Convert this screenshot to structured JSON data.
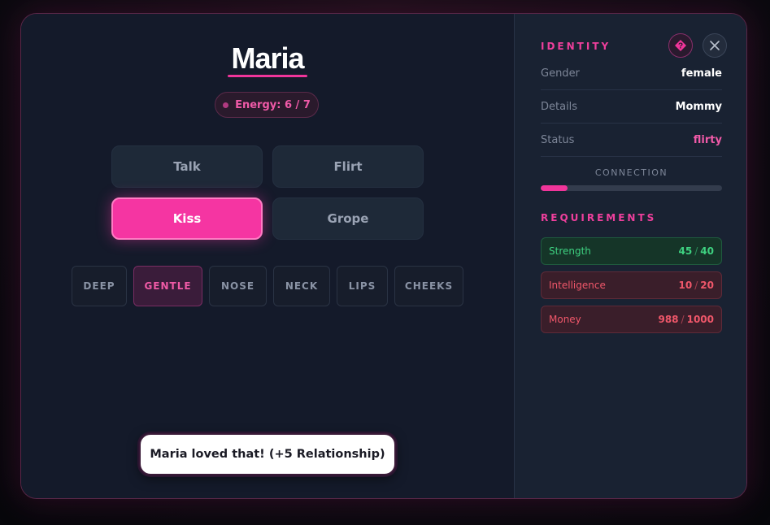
{
  "character": {
    "name": "Maria",
    "energy_label": "Energy: 6 / 7"
  },
  "actions": [
    {
      "label": "Talk",
      "active": false
    },
    {
      "label": "Flirt",
      "active": false
    },
    {
      "label": "Kiss",
      "active": true
    },
    {
      "label": "Grope",
      "active": false
    }
  ],
  "kiss_options": [
    {
      "label": "DEEP",
      "active": false
    },
    {
      "label": "GENTLE",
      "active": true
    },
    {
      "label": "NOSE",
      "active": false
    },
    {
      "label": "NECK",
      "active": false
    },
    {
      "label": "LIPS",
      "active": false
    },
    {
      "label": "CHEEKS",
      "active": false
    }
  ],
  "toast": "Maria loved that! (+5 Relationship)",
  "identity": {
    "title": "IDENTITY",
    "rows": [
      {
        "key": "Gender",
        "value": "female"
      },
      {
        "key": "Details",
        "value": "Mommy"
      },
      {
        "key": "Status",
        "value": "flirty"
      }
    ],
    "connection_label": "CONNECTION",
    "connection_level": 0.15
  },
  "requirements": {
    "title": "REQUIREMENTS",
    "items": [
      {
        "name": "Strength",
        "current": "45",
        "required": "40",
        "met": true
      },
      {
        "name": "Intelligence",
        "current": "10",
        "required": "20",
        "met": false
      },
      {
        "name": "Money",
        "current": "988",
        "required": "1000",
        "met": false
      }
    ],
    "separator": "/"
  },
  "icons": {
    "help": "question-diamond-icon",
    "close": "close-icon"
  },
  "colors": {
    "accent": "#f535a2",
    "success": "#3ed180",
    "danger": "#f0576a"
  }
}
